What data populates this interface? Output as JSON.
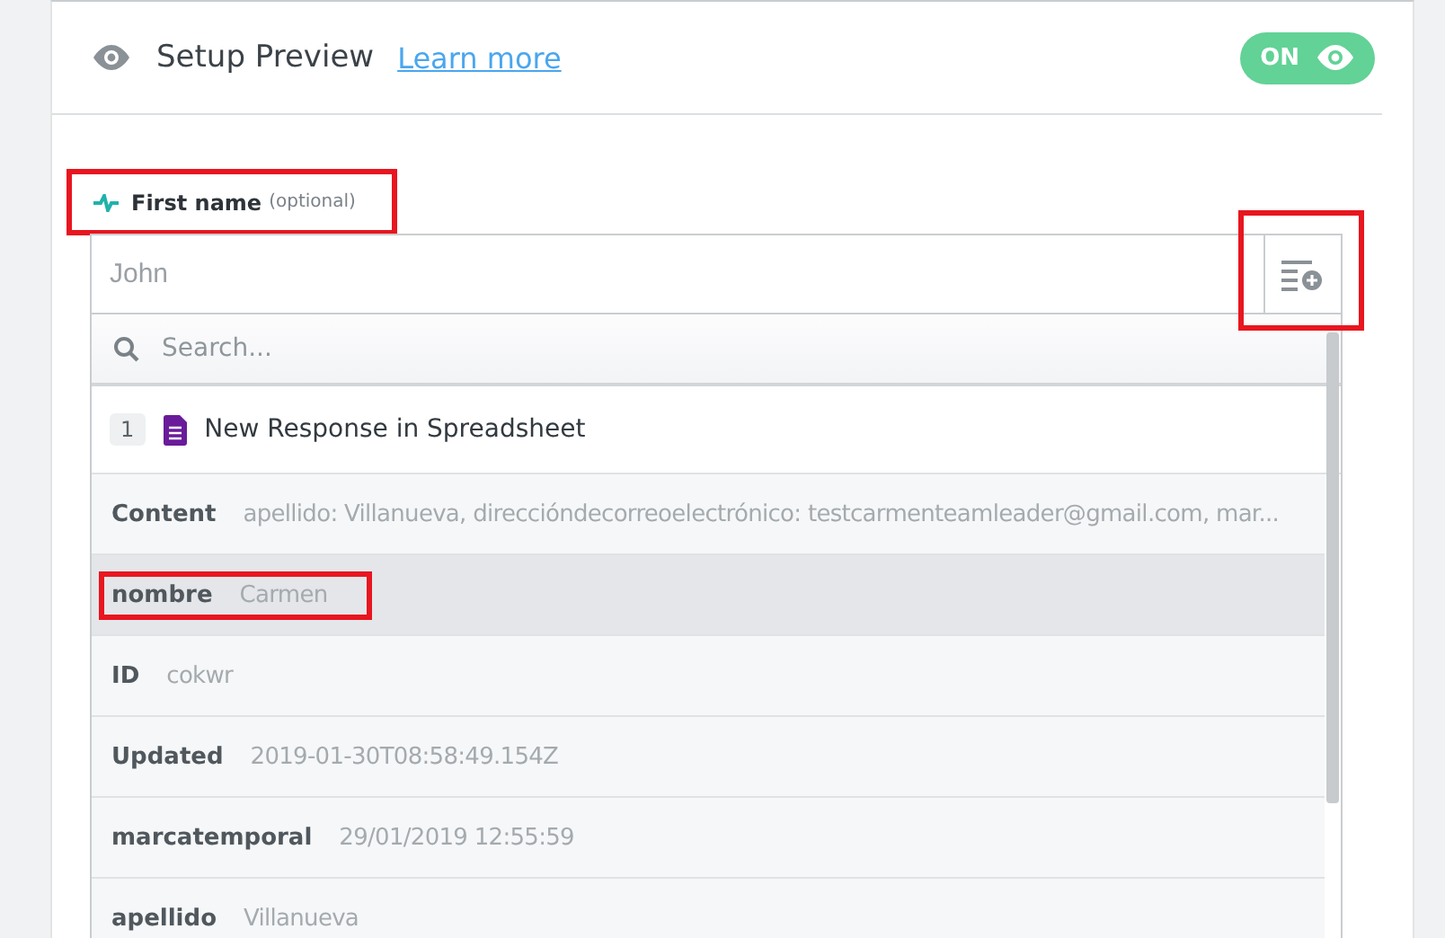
{
  "header": {
    "title": "Setup Preview",
    "link": "Learn more",
    "toggle": {
      "label": "ON",
      "on": true
    }
  },
  "field": {
    "label": "First name",
    "hint": "(optional)",
    "label_highlighted": true,
    "placeholder": "John",
    "button_highlighted": true
  },
  "dropdown": {
    "search_placeholder": "Search...",
    "step": {
      "number": "1",
      "title": "New Response in Spreadsheet"
    },
    "rows": [
      {
        "key": "Content",
        "value": "apellido: Villanueva, direccióndecorreoelectrónico: testcarmenteamleader@gmail.com, mar...",
        "selected": false,
        "highlighted": false
      },
      {
        "key": "nombre",
        "value": "Carmen",
        "selected": true,
        "highlighted": true
      },
      {
        "key": "ID",
        "value": "cokwr",
        "selected": false,
        "highlighted": false
      },
      {
        "key": "Updated",
        "value": "2019-01-30T08:58:49.154Z",
        "selected": false,
        "highlighted": false
      },
      {
        "key": "marcatemporal",
        "value": "29/01/2019 12:55:59",
        "selected": false,
        "highlighted": false
      },
      {
        "key": "apellido",
        "value": "Villanueva",
        "selected": false,
        "highlighted": false
      }
    ]
  }
}
